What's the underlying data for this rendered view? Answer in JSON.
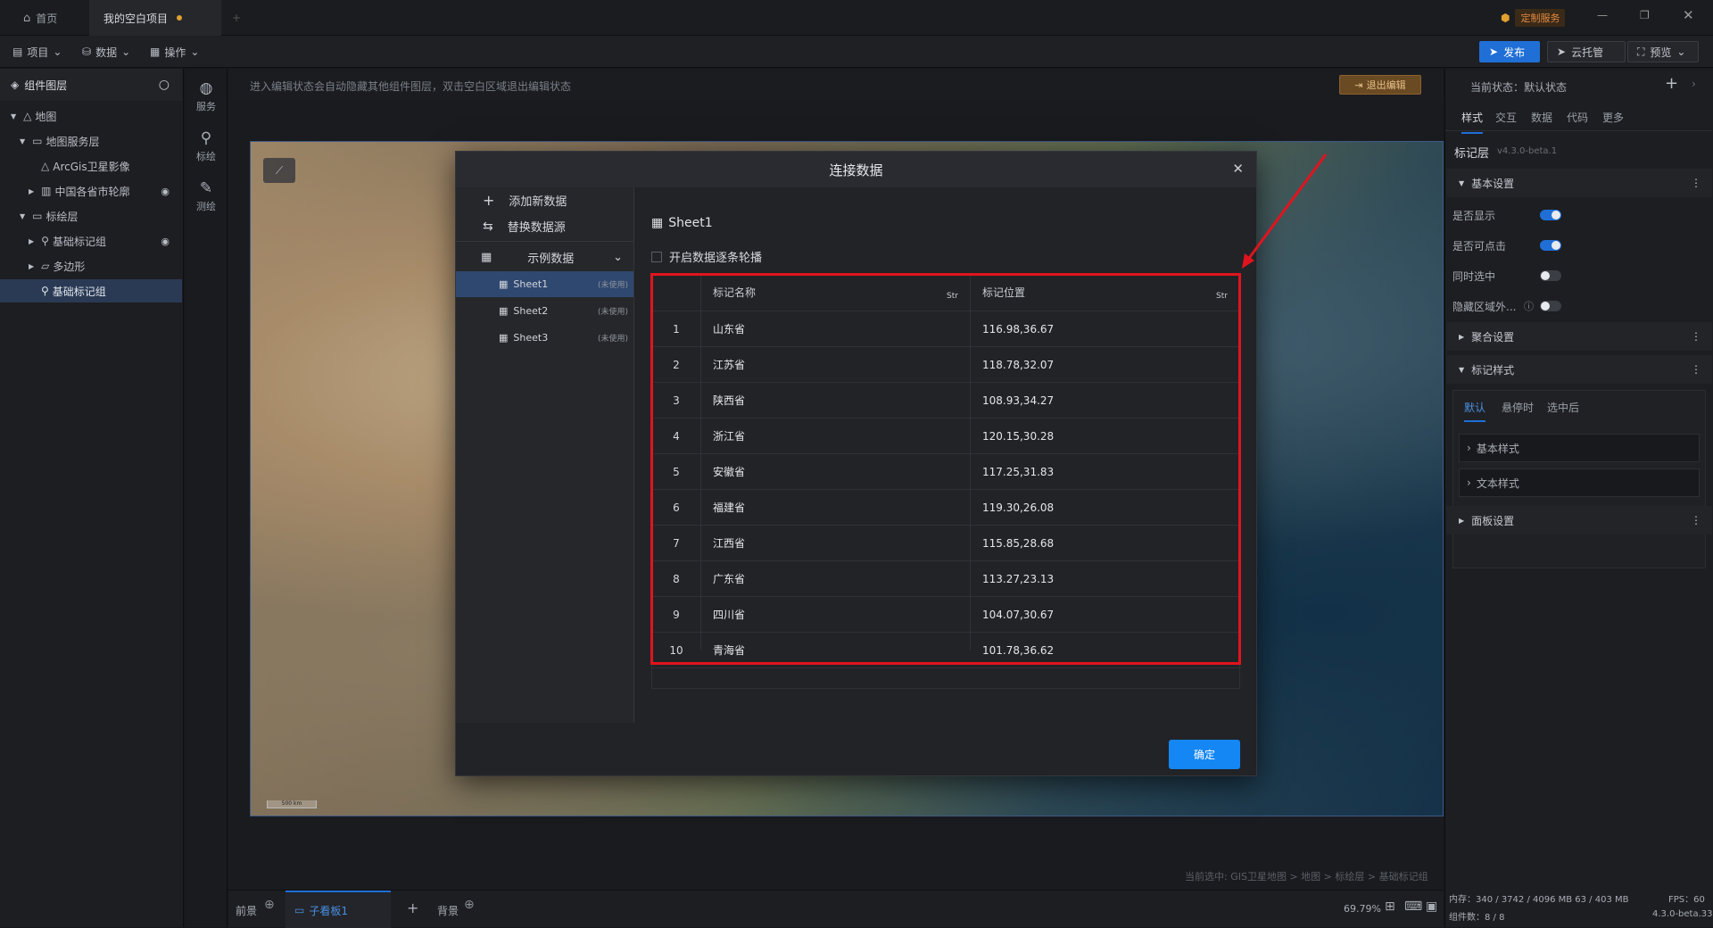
{
  "titlebar": {
    "home_tab": "首页",
    "project_tab": "我的空白项目",
    "service_badge": "定制服务"
  },
  "menubar": {
    "project": "项目",
    "data": "数据",
    "operation": "操作",
    "publish": "发布",
    "cloud": "云托管",
    "preview": "预览"
  },
  "leftpanel": {
    "title": "组件图层",
    "items": [
      {
        "label": "地图"
      },
      {
        "label": "地图服务层"
      },
      {
        "label": "ArcGis卫星影像"
      },
      {
        "label": "中国各省市轮廓"
      },
      {
        "label": "标绘层"
      },
      {
        "label": "基础标记组"
      },
      {
        "label": "多边形"
      },
      {
        "label": "基础标记组"
      }
    ]
  },
  "iconbar": {
    "service": "服务",
    "mark": "标绘",
    "measure": "测绘"
  },
  "canvas": {
    "hint": "进入编辑状态会自动隐藏其他组件图层，双击空白区域退出编辑状态",
    "exit_edit": "退出编辑",
    "scale": "500 km",
    "breadcrumb": "当前选中: GIS卫星地图 > 地图 > 标绘层 > 基础标记组"
  },
  "bottombar": {
    "front": "前景",
    "sub_panel": "子看板1",
    "back": "背景",
    "zoom": "69.79%",
    "memory": "内存：340 / 3742 / 4096 MB  63 / 403 MB",
    "components": "组件数：8 / 8",
    "fps": "FPS：60",
    "version": "4.3.0-beta.33"
  },
  "rightpanel": {
    "state": "当前状态：默认状态",
    "tabs": [
      "样式",
      "交互",
      "数据",
      "代码",
      "更多"
    ],
    "layer_name": "标记层",
    "layer_version": "v4.3.0-beta.1",
    "basic_settings": "基本设置",
    "toggles": [
      {
        "label": "是否显示",
        "on": true
      },
      {
        "label": "是否可点击",
        "on": true
      },
      {
        "label": "同时选中",
        "on": false
      },
      {
        "label": "隐藏区域外...",
        "on": false
      }
    ],
    "cluster_settings": "聚合设置",
    "marker_style": "标记样式",
    "style_tabs": [
      "默认",
      "悬停时",
      "选中后"
    ],
    "basic_style": "基本样式",
    "text_style": "文本样式",
    "panel_settings": "面板设置"
  },
  "modal": {
    "title": "连接数据",
    "add_new": "添加新数据",
    "replace_source": "替换数据源",
    "sample_data": "示例数据",
    "sheets": [
      {
        "name": "Sheet1",
        "tag": "(未使用)"
      },
      {
        "name": "Sheet2",
        "tag": "(未使用)"
      },
      {
        "name": "Sheet3",
        "tag": "(未使用)"
      }
    ],
    "sheet_title": "Sheet1",
    "carousel_label": "开启数据逐条轮播",
    "columns": [
      "标记名称",
      "标记位置"
    ],
    "type_icon": "Str",
    "rows": [
      {
        "idx": "1",
        "name": "山东省",
        "pos": "116.98,36.67"
      },
      {
        "idx": "2",
        "name": "江苏省",
        "pos": "118.78,32.07"
      },
      {
        "idx": "3",
        "name": "陕西省",
        "pos": "108.93,34.27"
      },
      {
        "idx": "4",
        "name": "浙江省",
        "pos": "120.15,30.28"
      },
      {
        "idx": "5",
        "name": "安徽省",
        "pos": "117.25,31.83"
      },
      {
        "idx": "6",
        "name": "福建省",
        "pos": "119.30,26.08"
      },
      {
        "idx": "7",
        "name": "江西省",
        "pos": "115.85,28.68"
      },
      {
        "idx": "8",
        "name": "广东省",
        "pos": "113.27,23.13"
      },
      {
        "idx": "9",
        "name": "四川省",
        "pos": "104.07,30.67"
      },
      {
        "idx": "10",
        "name": "青海省",
        "pos": "101.78,36.62"
      }
    ],
    "confirm": "确定"
  },
  "colors": {
    "accent": "#1487f5",
    "annotation": "#e0141e",
    "selected": "#2f4870"
  }
}
